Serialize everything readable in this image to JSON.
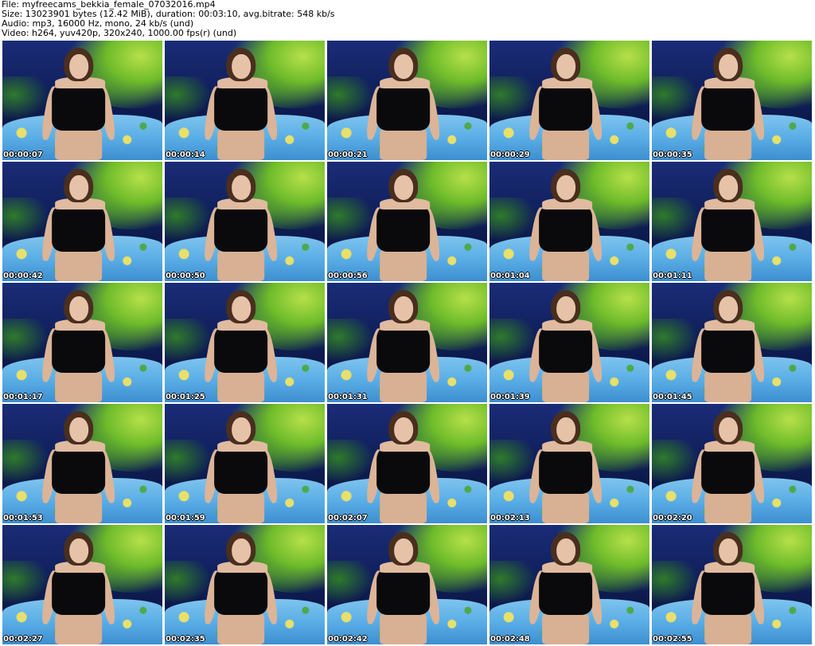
{
  "header": {
    "file": "File: myfreecams_bekkia_female_07032016.mp4",
    "size": "Size: 13023901 bytes (12.42 MiB), duration: 00:03:10, avg.bitrate: 548 kb/s",
    "audio": "Audio: mp3, 16000 Hz, mono, 24 kb/s (und)",
    "video": "Video: h264, yuv420p, 320x240, 1000.00 fps(r) (und)"
  },
  "timestamps": [
    "00:00:07",
    "00:00:14",
    "00:00:21",
    "00:00:29",
    "00:00:35",
    "00:00:42",
    "00:00:50",
    "00:00:56",
    "00:01:04",
    "00:01:11",
    "00:01:17",
    "00:01:25",
    "00:01:31",
    "00:01:39",
    "00:01:45",
    "00:01:53",
    "00:01:59",
    "00:02:07",
    "00:02:13",
    "00:02:20",
    "00:02:27",
    "00:02:35",
    "00:02:42",
    "00:02:48",
    "00:02:55"
  ]
}
